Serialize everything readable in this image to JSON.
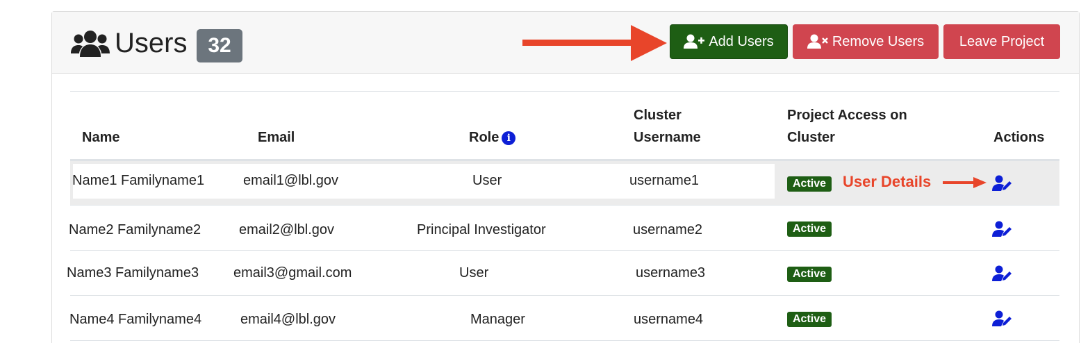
{
  "header": {
    "title": "Users",
    "count": "32",
    "buttons": {
      "add": "Add Users",
      "remove": "Remove Users",
      "leave": "Leave Project"
    }
  },
  "table": {
    "columns": {
      "name": "Name",
      "email": "Email",
      "role": "Role",
      "cluster_username_1": "Cluster",
      "cluster_username_2": "Username",
      "access_1": "Project Access on",
      "access_2": "Cluster",
      "actions": "Actions"
    },
    "rows": [
      {
        "name": "Name1 Familyname1",
        "email": "email1@lbl.gov",
        "role": "User",
        "username": "username1",
        "status": "Active"
      },
      {
        "name": "Name2 Familyname2",
        "email": "email2@lbl.gov",
        "role": "Principal Investigator",
        "username": "username2",
        "status": "Active"
      },
      {
        "name": "Name3 Familyname3",
        "email": "email3@gmail.com",
        "role": "User",
        "username": "username3",
        "status": "Active"
      },
      {
        "name": "Name4 Familyname4",
        "email": "email4@lbl.gov",
        "role": "Manager",
        "username": "username4",
        "status": "Active"
      }
    ]
  },
  "annotation": {
    "user_details": "User Details"
  },
  "icons": {
    "title": "users-icon",
    "add": "user-plus-icon",
    "remove": "user-times-icon",
    "info": "info-circle-icon",
    "edit": "user-edit-icon"
  },
  "colors": {
    "success": "#1e5e14",
    "danger": "#d0454f",
    "badge": "#6c757d",
    "link": "#0d1fd6",
    "annotation": "#e8452a"
  }
}
